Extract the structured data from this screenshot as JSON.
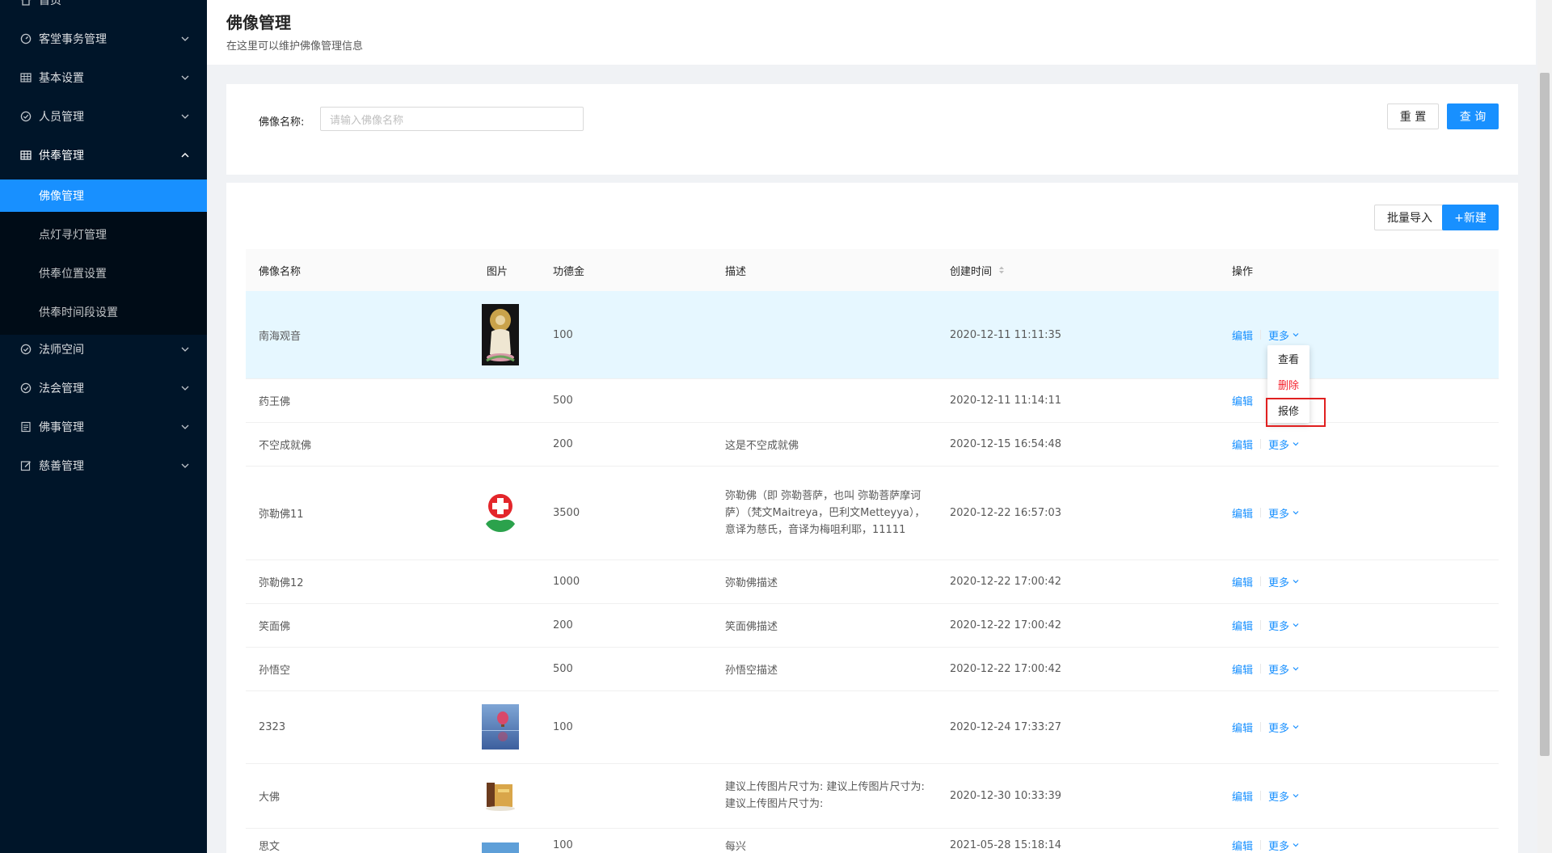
{
  "sidebar": {
    "items": [
      {
        "label": "首页",
        "icon": "home-icon"
      },
      {
        "label": "客堂事务管理",
        "icon": "dashboard-icon"
      },
      {
        "label": "基本设置",
        "icon": "table-icon"
      },
      {
        "label": "人员管理",
        "icon": "check-circle-icon"
      },
      {
        "label": "供奉管理",
        "icon": "table-icon"
      },
      {
        "label": "法师空间",
        "icon": "check-circle-icon"
      },
      {
        "label": "法会管理",
        "icon": "check-circle-icon"
      },
      {
        "label": "佛事管理",
        "icon": "file-icon"
      },
      {
        "label": "慈善管理",
        "icon": "form-icon"
      }
    ],
    "sub_items": [
      {
        "label": "佛像管理",
        "active": true
      },
      {
        "label": "点灯寻灯管理",
        "active": false
      },
      {
        "label": "供奉位置设置",
        "active": false
      },
      {
        "label": "供奉时间段设置",
        "active": false
      }
    ]
  },
  "header": {
    "title": "佛像管理",
    "subtitle": "在这里可以维护佛像管理信息"
  },
  "search": {
    "label": "佛像名称:",
    "placeholder": "请输入佛像名称",
    "reset_label": "重 置",
    "query_label": "查 询"
  },
  "toolbar": {
    "import_label": "批量导入",
    "new_label": "+新建"
  },
  "table": {
    "columns": [
      "佛像名称",
      "图片",
      "功德金",
      "描述",
      "创建时间",
      "操作"
    ],
    "edit_label": "编辑",
    "more_label": "更多",
    "rows": [
      {
        "name": "南海观音",
        "image": "guanyin",
        "amount": "100",
        "desc": "",
        "time": "2020-12-11 11:11:35"
      },
      {
        "name": "药王佛",
        "image": "",
        "amount": "500",
        "desc": "",
        "time": "2020-12-11 11:14:11"
      },
      {
        "name": "不空成就佛",
        "image": "",
        "amount": "200",
        "desc": "这是不空成就佛",
        "time": "2020-12-15 16:54:48"
      },
      {
        "name": "弥勒佛11",
        "image": "redcross",
        "amount": "3500",
        "desc": "弥勒佛（即 弥勒菩萨，也叫 弥勒菩萨摩诃萨）（梵文Maitreya，巴利文Metteyya），意译为慈氏，音译为梅咀利耶，11111",
        "time": "2020-12-22 16:57:03"
      },
      {
        "name": "弥勒佛12",
        "image": "",
        "amount": "1000",
        "desc": "弥勒佛描述",
        "time": "2020-12-22 17:00:42"
      },
      {
        "name": "笑面佛",
        "image": "",
        "amount": "200",
        "desc": "笑面佛描述",
        "time": "2020-12-22 17:00:42"
      },
      {
        "name": "孙悟空",
        "image": "",
        "amount": "500",
        "desc": "孙悟空描述",
        "time": "2020-12-22 17:00:42"
      },
      {
        "name": "2323",
        "image": "balloon",
        "amount": "100",
        "desc": "",
        "time": "2020-12-24 17:33:27"
      },
      {
        "name": "大佛",
        "image": "book",
        "amount": "",
        "desc": "建议上传图片尺寸为: 建议上传图片尺寸为: 建议上传图片尺寸为:",
        "time": "2020-12-30 10:33:39"
      },
      {
        "name": "思文",
        "image": "sky",
        "amount": "100",
        "desc": "每兴",
        "time": "2021-05-28 15:18:14"
      }
    ]
  },
  "dropdown": {
    "items": [
      "查看",
      "删除",
      "报修"
    ],
    "danger_color": "#f5222d"
  },
  "colors": {
    "primary": "#1890ff",
    "sidebar_bg": "#001529",
    "highlight": "#e02020"
  }
}
